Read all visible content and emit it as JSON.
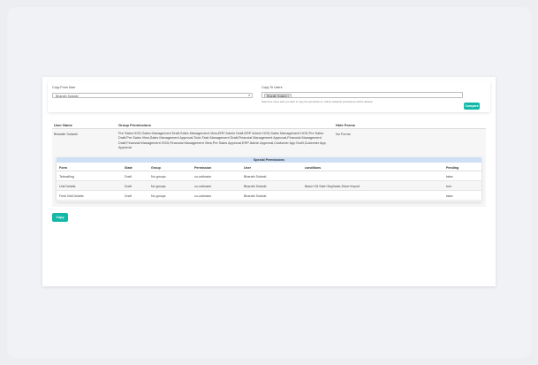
{
  "copy_from": {
    "label": "Copy From User",
    "value": "Bharath Solanki"
  },
  "copy_to": {
    "label": "Copy To Users",
    "chip": "Bharath Solanki",
    "hint": "Select the users who you want to copy the permission to. Admin assigned permissions will be deleted."
  },
  "buttons": {
    "compare": "Compare",
    "copy": "Copy"
  },
  "main_table": {
    "headers": [
      "User Name",
      "Group Permissions",
      "Hide Forms"
    ],
    "row": {
      "user_name": "Bharath Solanki",
      "group_permissions": "Pre Sales HOD,Sales Management Draft,Sales Management View,ERP Admin Draft,ERP Admin HOD,Sales Management HOD,Pre Sales Draft,Pre Sales View,Sales Management Approval,Todo Task Management Draft,Financial Management Approval,Financial Management Draft,Financial Management HOD,Financial Management View,Pre Sales Approval,ERP Admin Approval,Customer App Draft,Customer App Approval",
      "hide_forms": "No Forms"
    }
  },
  "special_permissions": {
    "title": "Special Permissions",
    "headers": [
      "Form",
      "State",
      "Group",
      "Permission",
      "User",
      "conditions",
      "Pending"
    ],
    "rows": [
      [
        "Telecalling",
        "Draft",
        "No groups",
        "co-ordinator",
        "Bharath Solanki",
        "",
        "false"
      ],
      [
        "Unit Details",
        "Draft",
        "No groups",
        "co-ordinator",
        "Bharath Solanki",
        "Basic+Oil Sale+Duplicate,Store+Import",
        "true"
      ],
      [
        "Field Visit Details",
        "Draft",
        "No groups",
        "co-ordinator",
        "Bharath Solanki",
        "",
        "false"
      ]
    ]
  },
  "colors": {
    "accent": "#13b9a7",
    "special_header": "#cfe0f6"
  },
  "icons": {
    "dropdown_caret": "▾",
    "chip_remove": "×"
  }
}
